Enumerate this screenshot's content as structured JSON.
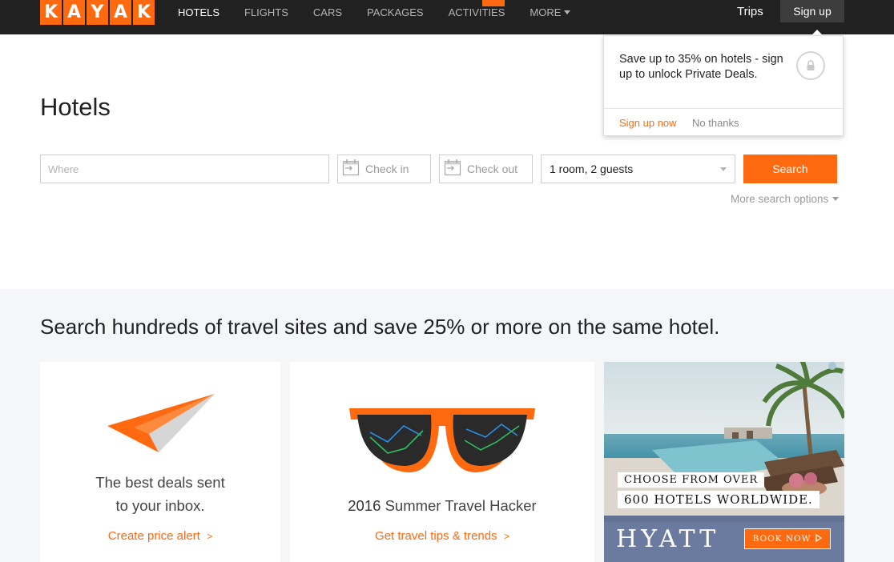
{
  "logo": {
    "letters": [
      "K",
      "A",
      "Y",
      "A",
      "K"
    ]
  },
  "nav": {
    "items": [
      {
        "label": "HOTELS",
        "active": true
      },
      {
        "label": "FLIGHTS"
      },
      {
        "label": "CARS"
      },
      {
        "label": "PACKAGES"
      },
      {
        "label": "ACTIVITIES"
      },
      {
        "label": "MORE"
      }
    ],
    "trips": "Trips",
    "signup": "Sign up"
  },
  "popover": {
    "text": "Save up to 35% on hotels - sign up to unlock Private Deals.",
    "signup_now": "Sign up now",
    "no_thanks": "No thanks",
    "icon": "lock-icon"
  },
  "page": {
    "title": "Hotels"
  },
  "search": {
    "where_placeholder": "Where",
    "checkin": "Check in",
    "checkout": "Check out",
    "guests": "1 room, 2 guests",
    "button": "Search",
    "more_options": "More search options"
  },
  "promo": {
    "tagline": "Search hundreds of travel sites and save 25% or more on the same hotel.",
    "card1": {
      "line1": "The best deals sent",
      "line2": "to your inbox.",
      "link": "Create price alert",
      "link_arrow": ">",
      "icon": "paper-plane-icon"
    },
    "card2": {
      "year": "2016",
      "title": "Summer Travel Hacker",
      "link": "Get travel tips & trends",
      "link_arrow": ">",
      "icon": "sunglasses-icon"
    }
  },
  "ad": {
    "line1": "CHOOSE FROM OVER",
    "line2": "600 HOTELS WORLDWIDE.",
    "brand": "HYATT",
    "cta": "BOOK NOW"
  },
  "colors": {
    "accent": "#ff690f",
    "nav_bg": "#212121",
    "section_bg": "#f5f6f8"
  }
}
